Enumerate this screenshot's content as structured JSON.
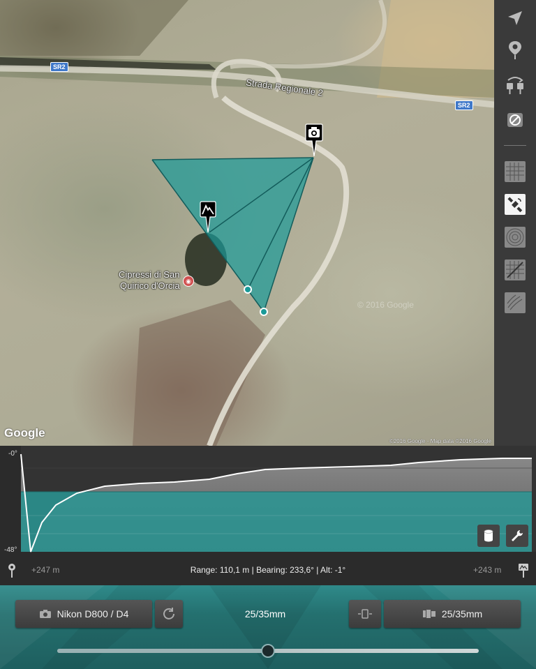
{
  "map": {
    "road_label": "Strada Regionale 2",
    "road_shields": [
      "SR2",
      "SR2"
    ],
    "poi_label_line1": "Cipressi di San",
    "poi_label_line2": "Quirico d'Orcia",
    "google_logo": "Google",
    "attribution": "©2016 Google - Map data ©2016 Google",
    "watermark": "© 2016 Google",
    "sight_color": "#1a9a98"
  },
  "sidebar": {
    "items": [
      {
        "name": "location-arrow-icon"
      },
      {
        "name": "pin-icon"
      },
      {
        "name": "swap-pins-icon"
      },
      {
        "name": "clear-icon"
      },
      {
        "name": "terrain-grid-layer-icon"
      },
      {
        "name": "satellite-layer-icon",
        "active": true
      },
      {
        "name": "contour-layer-icon"
      },
      {
        "name": "hybrid-grid-layer-icon"
      },
      {
        "name": "topo-layer-icon"
      }
    ]
  },
  "profile": {
    "top_angle": "-0°",
    "bottom_angle": "-48°",
    "left_elevation": "+247 m",
    "right_elevation": "+243 m",
    "info": "Range: 110,1 m | Bearing: 233,6° | Alt: -1°",
    "fill_color": "#2a9794"
  },
  "controls": {
    "camera_label": "Nikon D800 / D4",
    "focal_center": "25/35mm",
    "lens_label": "25/35mm",
    "slider_value": 0.5
  }
}
